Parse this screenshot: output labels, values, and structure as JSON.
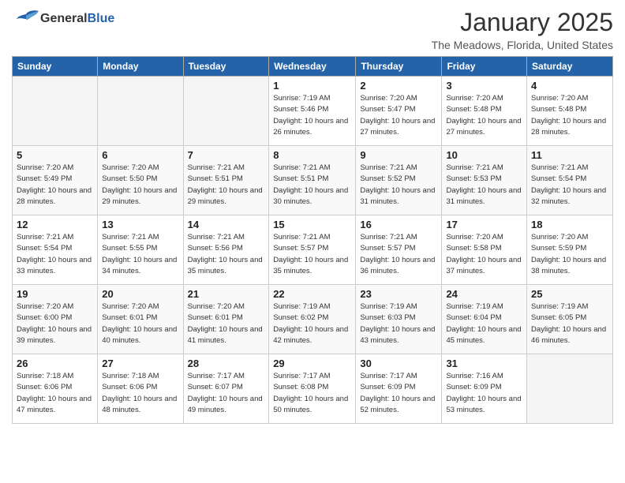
{
  "logo": {
    "general": "General",
    "blue": "Blue"
  },
  "title": "January 2025",
  "location": "The Meadows, Florida, United States",
  "weekdays": [
    "Sunday",
    "Monday",
    "Tuesday",
    "Wednesday",
    "Thursday",
    "Friday",
    "Saturday"
  ],
  "weeks": [
    [
      {
        "day": "",
        "sunrise": "",
        "sunset": "",
        "daylight": ""
      },
      {
        "day": "",
        "sunrise": "",
        "sunset": "",
        "daylight": ""
      },
      {
        "day": "",
        "sunrise": "",
        "sunset": "",
        "daylight": ""
      },
      {
        "day": "1",
        "sunrise": "Sunrise: 7:19 AM",
        "sunset": "Sunset: 5:46 PM",
        "daylight": "Daylight: 10 hours and 26 minutes."
      },
      {
        "day": "2",
        "sunrise": "Sunrise: 7:20 AM",
        "sunset": "Sunset: 5:47 PM",
        "daylight": "Daylight: 10 hours and 27 minutes."
      },
      {
        "day": "3",
        "sunrise": "Sunrise: 7:20 AM",
        "sunset": "Sunset: 5:48 PM",
        "daylight": "Daylight: 10 hours and 27 minutes."
      },
      {
        "day": "4",
        "sunrise": "Sunrise: 7:20 AM",
        "sunset": "Sunset: 5:48 PM",
        "daylight": "Daylight: 10 hours and 28 minutes."
      }
    ],
    [
      {
        "day": "5",
        "sunrise": "Sunrise: 7:20 AM",
        "sunset": "Sunset: 5:49 PM",
        "daylight": "Daylight: 10 hours and 28 minutes."
      },
      {
        "day": "6",
        "sunrise": "Sunrise: 7:20 AM",
        "sunset": "Sunset: 5:50 PM",
        "daylight": "Daylight: 10 hours and 29 minutes."
      },
      {
        "day": "7",
        "sunrise": "Sunrise: 7:21 AM",
        "sunset": "Sunset: 5:51 PM",
        "daylight": "Daylight: 10 hours and 29 minutes."
      },
      {
        "day": "8",
        "sunrise": "Sunrise: 7:21 AM",
        "sunset": "Sunset: 5:51 PM",
        "daylight": "Daylight: 10 hours and 30 minutes."
      },
      {
        "day": "9",
        "sunrise": "Sunrise: 7:21 AM",
        "sunset": "Sunset: 5:52 PM",
        "daylight": "Daylight: 10 hours and 31 minutes."
      },
      {
        "day": "10",
        "sunrise": "Sunrise: 7:21 AM",
        "sunset": "Sunset: 5:53 PM",
        "daylight": "Daylight: 10 hours and 31 minutes."
      },
      {
        "day": "11",
        "sunrise": "Sunrise: 7:21 AM",
        "sunset": "Sunset: 5:54 PM",
        "daylight": "Daylight: 10 hours and 32 minutes."
      }
    ],
    [
      {
        "day": "12",
        "sunrise": "Sunrise: 7:21 AM",
        "sunset": "Sunset: 5:54 PM",
        "daylight": "Daylight: 10 hours and 33 minutes."
      },
      {
        "day": "13",
        "sunrise": "Sunrise: 7:21 AM",
        "sunset": "Sunset: 5:55 PM",
        "daylight": "Daylight: 10 hours and 34 minutes."
      },
      {
        "day": "14",
        "sunrise": "Sunrise: 7:21 AM",
        "sunset": "Sunset: 5:56 PM",
        "daylight": "Daylight: 10 hours and 35 minutes."
      },
      {
        "day": "15",
        "sunrise": "Sunrise: 7:21 AM",
        "sunset": "Sunset: 5:57 PM",
        "daylight": "Daylight: 10 hours and 35 minutes."
      },
      {
        "day": "16",
        "sunrise": "Sunrise: 7:21 AM",
        "sunset": "Sunset: 5:57 PM",
        "daylight": "Daylight: 10 hours and 36 minutes."
      },
      {
        "day": "17",
        "sunrise": "Sunrise: 7:20 AM",
        "sunset": "Sunset: 5:58 PM",
        "daylight": "Daylight: 10 hours and 37 minutes."
      },
      {
        "day": "18",
        "sunrise": "Sunrise: 7:20 AM",
        "sunset": "Sunset: 5:59 PM",
        "daylight": "Daylight: 10 hours and 38 minutes."
      }
    ],
    [
      {
        "day": "19",
        "sunrise": "Sunrise: 7:20 AM",
        "sunset": "Sunset: 6:00 PM",
        "daylight": "Daylight: 10 hours and 39 minutes."
      },
      {
        "day": "20",
        "sunrise": "Sunrise: 7:20 AM",
        "sunset": "Sunset: 6:01 PM",
        "daylight": "Daylight: 10 hours and 40 minutes."
      },
      {
        "day": "21",
        "sunrise": "Sunrise: 7:20 AM",
        "sunset": "Sunset: 6:01 PM",
        "daylight": "Daylight: 10 hours and 41 minutes."
      },
      {
        "day": "22",
        "sunrise": "Sunrise: 7:19 AM",
        "sunset": "Sunset: 6:02 PM",
        "daylight": "Daylight: 10 hours and 42 minutes."
      },
      {
        "day": "23",
        "sunrise": "Sunrise: 7:19 AM",
        "sunset": "Sunset: 6:03 PM",
        "daylight": "Daylight: 10 hours and 43 minutes."
      },
      {
        "day": "24",
        "sunrise": "Sunrise: 7:19 AM",
        "sunset": "Sunset: 6:04 PM",
        "daylight": "Daylight: 10 hours and 45 minutes."
      },
      {
        "day": "25",
        "sunrise": "Sunrise: 7:19 AM",
        "sunset": "Sunset: 6:05 PM",
        "daylight": "Daylight: 10 hours and 46 minutes."
      }
    ],
    [
      {
        "day": "26",
        "sunrise": "Sunrise: 7:18 AM",
        "sunset": "Sunset: 6:06 PM",
        "daylight": "Daylight: 10 hours and 47 minutes."
      },
      {
        "day": "27",
        "sunrise": "Sunrise: 7:18 AM",
        "sunset": "Sunset: 6:06 PM",
        "daylight": "Daylight: 10 hours and 48 minutes."
      },
      {
        "day": "28",
        "sunrise": "Sunrise: 7:17 AM",
        "sunset": "Sunset: 6:07 PM",
        "daylight": "Daylight: 10 hours and 49 minutes."
      },
      {
        "day": "29",
        "sunrise": "Sunrise: 7:17 AM",
        "sunset": "Sunset: 6:08 PM",
        "daylight": "Daylight: 10 hours and 50 minutes."
      },
      {
        "day": "30",
        "sunrise": "Sunrise: 7:17 AM",
        "sunset": "Sunset: 6:09 PM",
        "daylight": "Daylight: 10 hours and 52 minutes."
      },
      {
        "day": "31",
        "sunrise": "Sunrise: 7:16 AM",
        "sunset": "Sunset: 6:09 PM",
        "daylight": "Daylight: 10 hours and 53 minutes."
      },
      {
        "day": "",
        "sunrise": "",
        "sunset": "",
        "daylight": ""
      }
    ]
  ]
}
